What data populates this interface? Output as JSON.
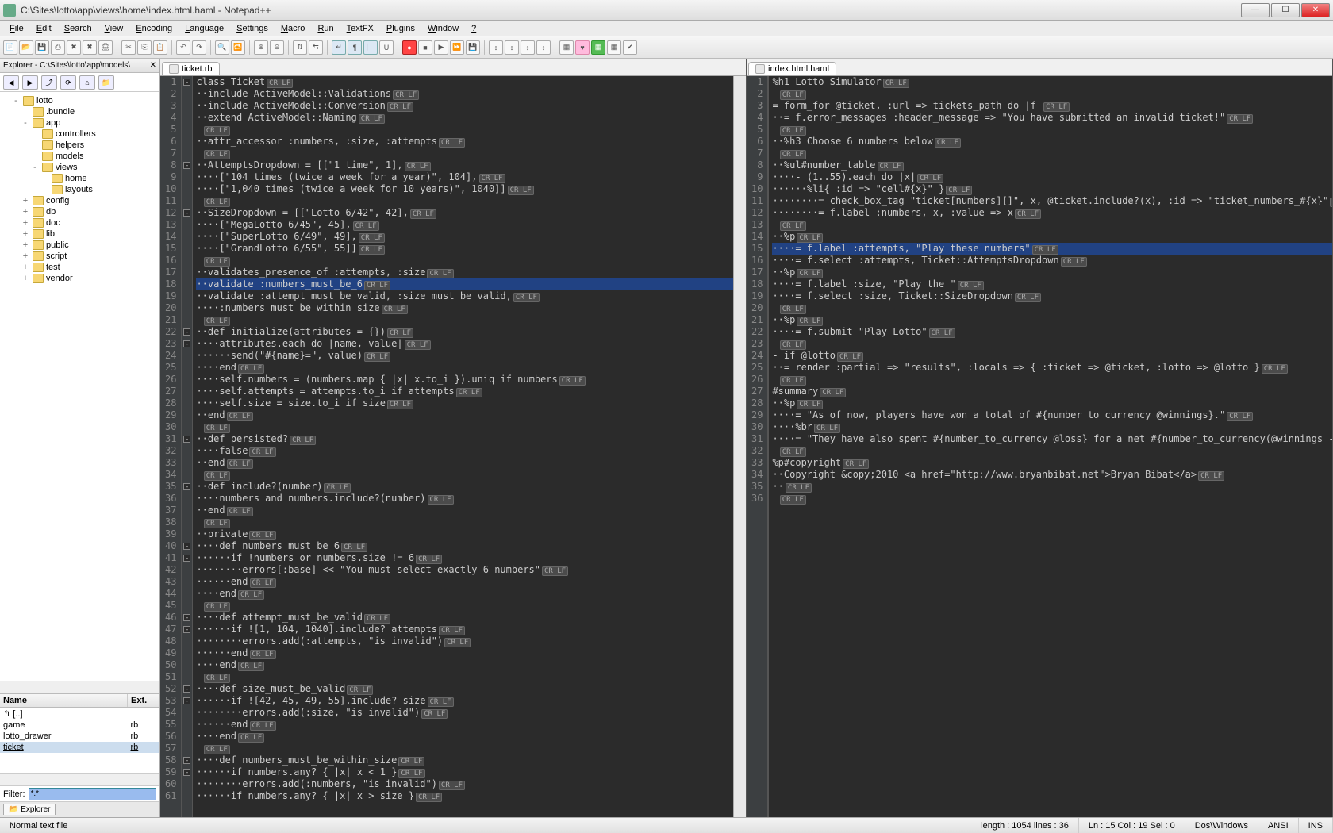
{
  "window": {
    "title": "C:\\Sites\\lotto\\app\\views\\home\\index.html.haml - Notepad++",
    "buttons": {
      "min": "—",
      "max": "☐",
      "close": "✕"
    }
  },
  "menubar": [
    "File",
    "Edit",
    "Search",
    "View",
    "Encoding",
    "Language",
    "Settings",
    "Macro",
    "Run",
    "TextFX",
    "Plugins",
    "Window",
    "?"
  ],
  "explorer": {
    "title": "Explorer - C:\\Sites\\lotto\\app\\models\\",
    "close": "✕",
    "tree_items": [
      {
        "lvl": 1,
        "tw": "-",
        "label": "lotto"
      },
      {
        "lvl": 2,
        "tw": "",
        "label": ".bundle"
      },
      {
        "lvl": 2,
        "tw": "-",
        "label": "app"
      },
      {
        "lvl": 3,
        "tw": "",
        "label": "controllers"
      },
      {
        "lvl": 3,
        "tw": "",
        "label": "helpers"
      },
      {
        "lvl": 3,
        "tw": "",
        "label": "models"
      },
      {
        "lvl": 3,
        "tw": "-",
        "label": "views"
      },
      {
        "lvl": 4,
        "tw": "",
        "label": "home"
      },
      {
        "lvl": 4,
        "tw": "",
        "label": "layouts"
      },
      {
        "lvl": 2,
        "tw": "+",
        "label": "config"
      },
      {
        "lvl": 2,
        "tw": "+",
        "label": "db"
      },
      {
        "lvl": 2,
        "tw": "+",
        "label": "doc"
      },
      {
        "lvl": 2,
        "tw": "+",
        "label": "lib"
      },
      {
        "lvl": 2,
        "tw": "+",
        "label": "public"
      },
      {
        "lvl": 2,
        "tw": "+",
        "label": "script"
      },
      {
        "lvl": 2,
        "tw": "+",
        "label": "test"
      },
      {
        "lvl": 2,
        "tw": "+",
        "label": "vendor"
      }
    ],
    "filelist": {
      "headers": [
        "Name",
        "Ext."
      ],
      "rows": [
        {
          "name": "[..]",
          "ext": "",
          "sel": false,
          "up": true
        },
        {
          "name": "game",
          "ext": "rb",
          "sel": false
        },
        {
          "name": "lotto_drawer",
          "ext": "rb",
          "sel": false
        },
        {
          "name": "ticket",
          "ext": "rb",
          "sel": true
        }
      ]
    },
    "filter_label": "Filter:",
    "filter_value": "*.*",
    "tab_label": "Explorer"
  },
  "left_tab": "ticket.rb",
  "right_tab": "index.html.haml",
  "left_lines": [
    {
      "n": 1,
      "fold": "-",
      "t": "<kw>class</kw> <cls>Ticket</cls>"
    },
    {
      "n": 2,
      "t": "<ws>··</ws><kw>include</kw> ActiveModel<pn>::</pn>Validations"
    },
    {
      "n": 3,
      "t": "<ws>··</ws><kw>include</kw> ActiveModel<pn>::</pn>Conversion"
    },
    {
      "n": 4,
      "t": "<ws>··</ws><kw>extend</kw> ActiveModel<pn>::</pn>Naming"
    },
    {
      "n": 5,
      "t": ""
    },
    {
      "n": 6,
      "t": "<ws>··</ws>attr_accessor <sym>:numbers</sym>, <sym>:size</sym>, <sym>:attempts</sym>"
    },
    {
      "n": 7,
      "t": ""
    },
    {
      "n": 8,
      "fold": "-",
      "t": "<ws>··</ws>AttemptsDropdown <pn>=</pn> <pn>[[</pn><str>\"1 time\"</str>, <num>1</num><pn>],</pn>"
    },
    {
      "n": 9,
      "t": "<ws>····</ws><pn>[</pn><str>\"104 times (twice a week for a year)\"</str>, <num>104</num><pn>],</pn>"
    },
    {
      "n": 10,
      "t": "<ws>····</ws><pn>[</pn><str>\"1,040 times (twice a week for 10 years)\"</str>, <num>1040</num><pn>]]</pn>"
    },
    {
      "n": 11,
      "t": ""
    },
    {
      "n": 12,
      "fold": "-",
      "t": "<ws>··</ws>SizeDropdown <pn>=</pn> <pn>[[</pn><str>\"Lotto 6/42\"</str>, <num>42</num><pn>],</pn>"
    },
    {
      "n": 13,
      "t": "<ws>····</ws><pn>[</pn><str>\"MegaLotto 6/45\"</str>, <num>45</num><pn>],</pn>"
    },
    {
      "n": 14,
      "t": "<ws>····</ws><pn>[</pn><str>\"SuperLotto 6/49\"</str>, <num>49</num><pn>],</pn>"
    },
    {
      "n": 15,
      "t": "<ws>····</ws><pn>[</pn><str>\"GrandLotto 6/55\"</str>, <num>55</num><pn>]]</pn>"
    },
    {
      "n": 16,
      "t": ""
    },
    {
      "n": 17,
      "t": "<ws>··</ws>validates_presence_of <sym>:attempts</sym>, <sym>:size</sym>"
    },
    {
      "n": 18,
      "hl": true,
      "t": "<ws>··</ws>validate <sym>:numbers_must_be_6</sym>"
    },
    {
      "n": 19,
      "t": "<ws>··</ws>validate <sym>:attempt_must_be_valid</sym>, <sym>:size_must_be_valid</sym>,"
    },
    {
      "n": 20,
      "t": "<ws>····</ws><sym>:numbers_must_be_within_size</sym>"
    },
    {
      "n": 21,
      "t": ""
    },
    {
      "n": 22,
      "fold": "-",
      "t": "<ws>··</ws><kw>def</kw> <cls>initialize</cls><pn>(</pn>attributes <pn>=</pn> <pn>{})</pn>"
    },
    {
      "n": 23,
      "fold": "-",
      "t": "<ws>····</ws>attributes.each <kw>do</kw> <pn>|</pn>name, value<pn>|</pn>"
    },
    {
      "n": 24,
      "t": "<ws>······</ws>send<pn>(</pn><str>\"#{name}=\"</str>, value<pn>)</pn>"
    },
    {
      "n": 25,
      "t": "<ws>····</ws><kw>end</kw>"
    },
    {
      "n": 26,
      "t": "<ws>····</ws><kw>self</kw>.numbers <pn>=</pn> <pn>(</pn>numbers.map <pn>{</pn> <pn>|</pn>x<pn>|</pn> x.to_i <pn>}).</pn>uniq <kw>if</kw> numbers"
    },
    {
      "n": 27,
      "t": "<ws>····</ws><kw>self</kw>.attempts <pn>=</pn> attempts.to_i <kw>if</kw> attempts"
    },
    {
      "n": 28,
      "t": "<ws>····</ws><kw>self</kw>.size <pn>=</pn> size.to_i <kw>if</kw> size"
    },
    {
      "n": 29,
      "t": "<ws>··</ws><kw>end</kw>"
    },
    {
      "n": 30,
      "t": ""
    },
    {
      "n": 31,
      "fold": "-",
      "t": "<ws>··</ws><kw>def</kw> <cls>persisted?</cls>"
    },
    {
      "n": 32,
      "t": "<ws>····</ws><kw>false</kw>"
    },
    {
      "n": 33,
      "t": "<ws>··</ws><kw>end</kw>"
    },
    {
      "n": 34,
      "t": ""
    },
    {
      "n": 35,
      "fold": "-",
      "t": "<ws>··</ws><kw>def</kw> <cls>include?</cls><pn>(</pn>number<pn>)</pn>"
    },
    {
      "n": 36,
      "t": "<ws>····</ws>numbers <kw>and</kw> numbers.include?<pn>(</pn>number<pn>)</pn>"
    },
    {
      "n": 37,
      "t": "<ws>··</ws><kw>end</kw>"
    },
    {
      "n": 38,
      "t": ""
    },
    {
      "n": 39,
      "t": "<ws>··</ws><kw>private</kw>"
    },
    {
      "n": 40,
      "fold": "-",
      "t": "<ws>····</ws><kw>def</kw> <cls>numbers_must_be_6</cls>"
    },
    {
      "n": 41,
      "fold": "-",
      "t": "<ws>······</ws><kw>if</kw> <pn>!</pn>numbers <kw>or</kw> numbers.size <pn>!=</pn> <num>6</num>"
    },
    {
      "n": 42,
      "t": "<ws>········</ws>errors<pn>[</pn><sym>:base</sym><pn>]</pn> <pn>&lt;&lt;</pn> <str>\"You must select exactly 6 numbers\"</str>"
    },
    {
      "n": 43,
      "t": "<ws>······</ws><kw>end</kw>"
    },
    {
      "n": 44,
      "t": "<ws>····</ws><kw>end</kw>"
    },
    {
      "n": 45,
      "t": ""
    },
    {
      "n": 46,
      "fold": "-",
      "t": "<ws>····</ws><kw>def</kw> <cls>attempt_must_be_valid</cls>"
    },
    {
      "n": 47,
      "fold": "-",
      "t": "<ws>······</ws><kw>if</kw> <pn>![</pn><num>1</num>, <num>104</num>, <num>1040</num><pn>].</pn>include? attempts"
    },
    {
      "n": 48,
      "t": "<ws>········</ws>errors.add<pn>(</pn><sym>:attempts</sym>, <str>\"is invalid\"</str><pn>)</pn>"
    },
    {
      "n": 49,
      "t": "<ws>······</ws><kw>end</kw>"
    },
    {
      "n": 50,
      "t": "<ws>····</ws><kw>end</kw>"
    },
    {
      "n": 51,
      "t": ""
    },
    {
      "n": 52,
      "fold": "-",
      "t": "<ws>····</ws><kw>def</kw> <cls>size_must_be_valid</cls>"
    },
    {
      "n": 53,
      "fold": "-",
      "t": "<ws>······</ws><kw>if</kw> <pn>![</pn><num>42</num>, <num>45</num>, <num>49</num>, <num>55</num><pn>].</pn>include? size"
    },
    {
      "n": 54,
      "t": "<ws>········</ws>errors.add<pn>(</pn><sym>:size</sym>, <str>\"is invalid\"</str><pn>)</pn>"
    },
    {
      "n": 55,
      "t": "<ws>······</ws><kw>end</kw>"
    },
    {
      "n": 56,
      "t": "<ws>····</ws><kw>end</kw>"
    },
    {
      "n": 57,
      "t": ""
    },
    {
      "n": 58,
      "fold": "-",
      "t": "<ws>····</ws><kw>def</kw> <cls>numbers_must_be_within_size</cls>"
    },
    {
      "n": 59,
      "fold": "-",
      "t": "<ws>······</ws><kw>if</kw> numbers.any? <pn>{</pn> <pn>|</pn>x<pn>|</pn> x <pn>&lt;</pn> <num>1</num> <pn>}</pn>"
    },
    {
      "n": 60,
      "t": "<ws>········</ws>errors.add<pn>(</pn><sym>:numbers</sym>, <str>\"is invalid\"</str><pn>)</pn>"
    },
    {
      "n": 61,
      "t": "<ws>······</ws><kw>if</kw> numbers.any? <pn>{</pn> <pn>|</pn>x<pn>|</pn> x <pn>&gt;</pn> size <pn>}</pn>"
    }
  ],
  "right_lines": [
    {
      "n": 1,
      "t": "<sym>%h1</sym> Lotto Simulator"
    },
    {
      "n": 2,
      "t": ""
    },
    {
      "n": 3,
      "t": "<pn>=</pn> form_for <sym>@ticket</sym>, <sym>:url</sym> <pn>=&gt;</pn> tickets_path <kw>do</kw> <pn>|</pn>f<pn>|</pn>"
    },
    {
      "n": 4,
      "t": "<ws>··</ws><pn>=</pn> f.error_messages <sym>:header_message</sym> <pn>=&gt;</pn> <str>\"You have submitted an invalid ticket!\"</str>"
    },
    {
      "n": 5,
      "t": ""
    },
    {
      "n": 6,
      "t": "<ws>··</ws><sym>%h3</sym> Choose 6 numbers below"
    },
    {
      "n": 7,
      "t": ""
    },
    {
      "n": 8,
      "t": "<ws>··</ws><sym>%ul#number_table</sym>"
    },
    {
      "n": 9,
      "t": "<ws>····</ws><pn>-</pn> <pn>(</pn><num>1</num><pn>..</pn><num>55</num><pn>).</pn>each <kw>do</kw> <pn>|</pn>x<pn>|</pn>"
    },
    {
      "n": 10,
      "t": "<ws>······</ws><sym>%li</sym><pn>{</pn> <sym>:id</sym> <pn>=&gt;</pn> <str>\"cell#{x}\"</str> <pn>}</pn>"
    },
    {
      "n": 11,
      "t": "<ws>········</ws><pn>=</pn> check_box_tag <str>\"ticket[numbers][]\"</str>, x, <sym>@ticket</sym>.include?<pn>(</pn>x<pn>)</pn>, <sym>:id</sym> <pn>=&gt;</pn> <str>\"ticket_numbers_#{x}\"</str>"
    },
    {
      "n": 12,
      "t": "<ws>········</ws><pn>=</pn> f.label <sym>:numbers</sym>, x, <sym>:value</sym> <pn>=&gt;</pn> x"
    },
    {
      "n": 13,
      "t": ""
    },
    {
      "n": 14,
      "t": "<ws>··</ws><sym>%p</sym>"
    },
    {
      "n": 15,
      "hl": true,
      "t": "<ws>····</ws><pn>=</pn> f.label <sym>:attempts</sym>, <str>\"Play these numbers\"</str>"
    },
    {
      "n": 16,
      "t": "<ws>····</ws><pn>=</pn> f.select <sym>:attempts</sym>, Ticket<pn>::</pn>AttemptsDropdown"
    },
    {
      "n": 17,
      "t": "<ws>··</ws><sym>%p</sym>"
    },
    {
      "n": 18,
      "t": "<ws>····</ws><pn>=</pn> f.label <sym>:size</sym>, <str>\"Play the \"</str>"
    },
    {
      "n": 19,
      "t": "<ws>····</ws><pn>=</pn> f.select <sym>:size</sym>, Ticket<pn>::</pn>SizeDropdown"
    },
    {
      "n": 20,
      "t": ""
    },
    {
      "n": 21,
      "t": "<ws>··</ws><sym>%p</sym>"
    },
    {
      "n": 22,
      "t": "<ws>····</ws><pn>=</pn> f.submit <str>\"Play Lotto\"</str>"
    },
    {
      "n": 23,
      "t": ""
    },
    {
      "n": 24,
      "t": "<pn>-</pn> <kw>if</kw> <sym>@lotto</sym>"
    },
    {
      "n": 25,
      "t": "<ws>··</ws><pn>=</pn> render <sym>:partial</sym> <pn>=&gt;</pn> <str>\"results\"</str>, <sym>:locals</sym> <pn>=&gt;</pn> <pn>{</pn> <sym>:ticket</sym> <pn>=&gt;</pn> <sym>@ticket</sym>, <sym>:lotto</sym> <pn>=&gt;</pn> <sym>@lotto</sym> <pn>}</pn>"
    },
    {
      "n": 26,
      "t": ""
    },
    {
      "n": 27,
      "t": "<sym>#summary</sym>"
    },
    {
      "n": 28,
      "t": "<ws>··</ws><sym>%p</sym>"
    },
    {
      "n": 29,
      "t": "<ws>····</ws><pn>=</pn> <str>\"As of now, players have won a total of #{number_to_currency @winnings}.\"</str>"
    },
    {
      "n": 30,
      "t": "<ws>····</ws><sym>%br</sym>"
    },
    {
      "n": 31,
      "t": "<ws>····</ws><pn>=</pn> <str>\"They have also spent #{number_to_currency @loss} for a net #{number_to_currency(@winnings - @loss)}\"</str>"
    },
    {
      "n": 32,
      "t": ""
    },
    {
      "n": 33,
      "t": "<sym>%p#copyright</sym>"
    },
    {
      "n": 34,
      "t": "<ws>··</ws>Copyright &amp;copy;2010 &lt;a href=<str>\"http://www.bryanbibat.net\"</str>&gt;Bryan Bibat&lt;/a&gt;"
    },
    {
      "n": 35,
      "t": "<ws>··</ws>"
    },
    {
      "n": 36,
      "t": ""
    }
  ],
  "statusbar": {
    "filetype": "Normal text file",
    "length": "length : 1054    lines : 36",
    "pos": "Ln : 15    Col : 19    Sel : 0",
    "eol": "Dos\\Windows",
    "enc": "ANSI",
    "ovr": "INS"
  }
}
